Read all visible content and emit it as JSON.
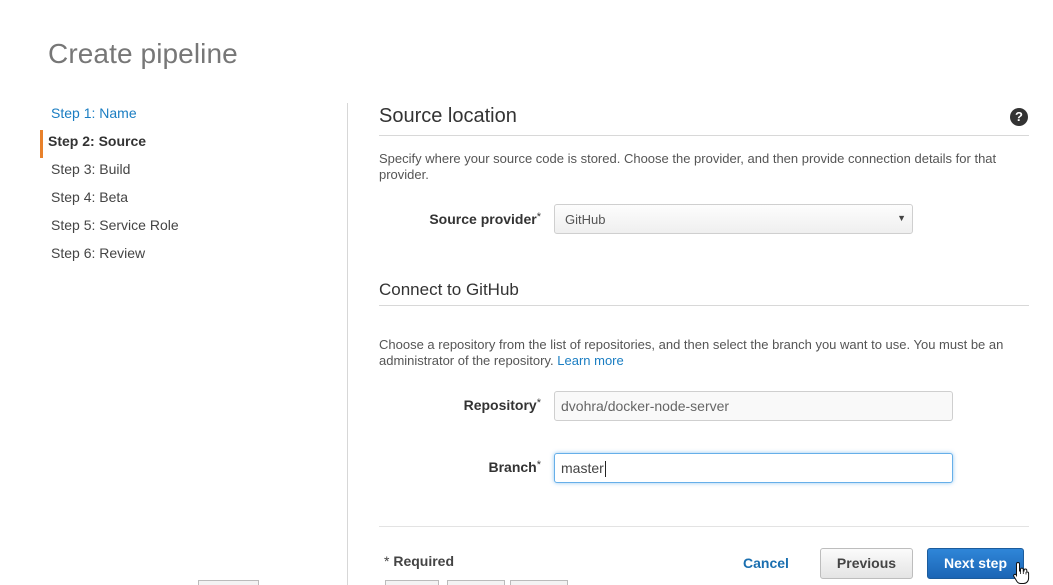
{
  "page": {
    "title": "Create pipeline"
  },
  "steps": [
    {
      "label": "Step 1: Name",
      "state": "link"
    },
    {
      "label": "Step 2: Source",
      "state": "current"
    },
    {
      "label": "Step 3: Build",
      "state": "default"
    },
    {
      "label": "Step 4: Beta",
      "state": "default"
    },
    {
      "label": "Step 5: Service Role",
      "state": "default"
    },
    {
      "label": "Step 6: Review",
      "state": "default"
    }
  ],
  "source_location": {
    "title": "Source location",
    "help_icon": "?",
    "description": "Specify where your source code is stored. Choose the provider, and then provide connection details for that provider.",
    "provider_label": "Source provider",
    "required_mark": "*",
    "provider_value": "GitHub",
    "caret_icon": "▼"
  },
  "github": {
    "title": "Connect to GitHub",
    "description": "Choose a repository from the list of repositories, and then select the branch you want to use. You must be an administrator of the repository.",
    "learn_more": "Learn more",
    "repository_label": "Repository",
    "repository_value": "dvohra/docker-node-server",
    "branch_label": "Branch",
    "branch_value": "master"
  },
  "footer": {
    "required_star": "*",
    "required_text": " Required",
    "cancel": "Cancel",
    "previous": "Previous",
    "next": "Next step"
  },
  "colors": {
    "accent_link": "#1a7dc2",
    "current_step_marker": "#e8812b",
    "primary_button": "#1b65b5"
  }
}
